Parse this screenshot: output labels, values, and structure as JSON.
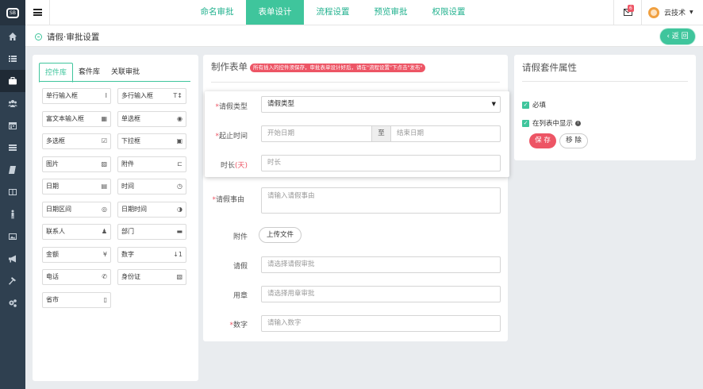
{
  "app": {
    "logo_text": "SB"
  },
  "left_nav": {
    "items": [
      {
        "icon": "home-icon",
        "active": false
      },
      {
        "icon": "list-icon",
        "active": false
      },
      {
        "icon": "briefcase-icon",
        "active": true
      },
      {
        "icon": "users-icon",
        "active": false
      },
      {
        "icon": "calendar-icon",
        "active": false
      },
      {
        "icon": "server-icon",
        "active": false
      },
      {
        "icon": "book-icon",
        "active": false
      },
      {
        "icon": "columns-icon",
        "active": false
      },
      {
        "icon": "person-icon",
        "active": false
      },
      {
        "icon": "image-icon",
        "active": false
      },
      {
        "icon": "megaphone-icon",
        "active": false
      },
      {
        "icon": "hammer-icon",
        "active": false
      },
      {
        "icon": "cogs-icon",
        "active": false
      }
    ]
  },
  "topbar": {
    "tabs": [
      "命名审批",
      "表单设计",
      "流程设置",
      "预览审批",
      "权限设置"
    ],
    "active_tab": 1,
    "mail_badge": "6",
    "user_name": "云技术"
  },
  "page": {
    "title": "请假·审批设置",
    "back_label": "返 回"
  },
  "library": {
    "tabs": [
      "控件库",
      "套件库",
      "关联审批"
    ],
    "controls": [
      {
        "label": "单行输入框",
        "icon": "Ⅰ"
      },
      {
        "label": "多行输入框",
        "icon": "T↕"
      },
      {
        "label": "富文本输入框",
        "icon": "▦"
      },
      {
        "label": "单选框",
        "icon": "◉"
      },
      {
        "label": "多选框",
        "icon": "☑"
      },
      {
        "label": "下拉框",
        "icon": "▣"
      },
      {
        "label": "图片",
        "icon": "▨"
      },
      {
        "label": "附件",
        "icon": "⊏"
      },
      {
        "label": "日期",
        "icon": "▤"
      },
      {
        "label": "时间",
        "icon": "◷"
      },
      {
        "label": "日期区间",
        "icon": "◎"
      },
      {
        "label": "日期时间",
        "icon": "◑"
      },
      {
        "label": "联系人",
        "icon": "♟"
      },
      {
        "label": "部门",
        "icon": "▬"
      },
      {
        "label": "金额",
        "icon": "¥"
      },
      {
        "label": "数字",
        "icon": "↓1"
      },
      {
        "label": "电话",
        "icon": "✆"
      },
      {
        "label": "身份证",
        "icon": "▧"
      },
      {
        "label": "省市",
        "icon": "▯"
      }
    ]
  },
  "form": {
    "title": "制作表单",
    "notice": "所有插入的控件须保存，审批表单设计好后，请在\"流程设置\"下点击\"发布\"",
    "suite": {
      "type_label": "请假类型",
      "type_value": "请假类型",
      "range_label": "起止时间",
      "start_placeholder": "开始日期",
      "range_sep": "至",
      "end_placeholder": "结束日期",
      "duration_label": "时长",
      "duration_unit": "(天)",
      "duration_placeholder": "时长"
    },
    "reason_label": "请假事由",
    "reason_placeholder": "请输入请假事由",
    "attach_label": "附件",
    "upload_label": "上传文件",
    "leave_label": "请假",
    "leave_placeholder": "请选择请假审批",
    "seal_label": "用章",
    "seal_placeholder": "请选择用章审批",
    "number_label": "数字",
    "number_placeholder": "请输入数字"
  },
  "props": {
    "title": "请假套件属性",
    "required_label": "必填",
    "show_in_list_label": "在列表中显示",
    "save_label": "保 存",
    "remove_label": "移 除"
  }
}
